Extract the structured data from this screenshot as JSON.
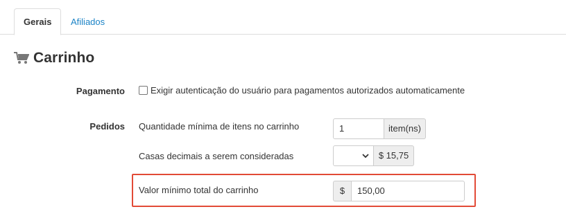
{
  "tabs": [
    {
      "label": "Gerais",
      "active": true
    },
    {
      "label": "Afiliados",
      "active": false
    }
  ],
  "section": {
    "title": "Carrinho",
    "icon": "shopping-cart-icon"
  },
  "payment": {
    "label": "Pagamento",
    "checkbox_label": "Exigir autenticação do usuário para pagamentos autorizados automaticamente",
    "checked": false
  },
  "orders": {
    "label": "Pedidos",
    "min_items": {
      "label": "Quantidade mínima de itens no carrinho",
      "value": "1",
      "unit": "item(ns)"
    },
    "decimals": {
      "label": "Casas decimais a serem consideradas",
      "selected": "",
      "preview": "$ 15,75"
    },
    "min_total": {
      "label": "Valor mínimo total do carrinho",
      "currency": "$",
      "value": "150,00"
    }
  },
  "colors": {
    "link": "#1b83c6",
    "highlight": "#e24a36"
  }
}
